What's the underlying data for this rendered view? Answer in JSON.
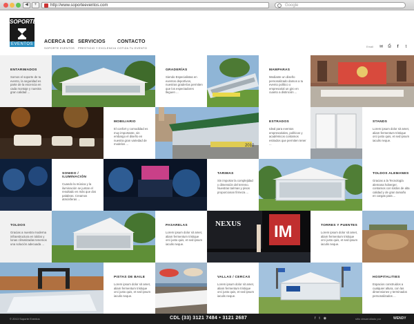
{
  "browser": {
    "url": "http://www.soporteeventos.com",
    "search_placeholder": "Google",
    "back": "◀",
    "forward": "▶",
    "add_tab": "+"
  },
  "logo": {
    "top_text": "SOPORTE",
    "bottom_text": "EVENTOS"
  },
  "menu": [
    {
      "title": "ACERCA DE",
      "subtitle": "SOPORTE EVENTOS"
    },
    {
      "title": "SERVICIOS",
      "subtitle": "PRESTIGIO Y EXCLENCIA"
    },
    {
      "title": "CONTACTO",
      "subtitle": "COTIZA TU EVENTO"
    }
  ],
  "social": {
    "label": "Email",
    "icons": [
      "envelope-icon",
      "printer-icon",
      "facebook-icon",
      "twitter-icon"
    ]
  },
  "tiles": [
    {
      "title": "ENTARIMADOS",
      "text": "Somos el soporte de tu evento, la seguridad es parte de la escencia en cada montaje y nuestra gran calidad ..."
    },
    {
      "title": "GRADERÍAS",
      "text": "Siendo Especialistas en eventos deportivos, nuestras graderías permiten que los espectadores lleguen ..."
    },
    {
      "title": "MAMPARAS",
      "text": "Mediante un diseño personalizado damos a tu evento político o empresarial un giro en cuanto a distinción ..."
    },
    {
      "title": "MOBILIARIO",
      "text": "El confort y comodidad es muy importante, sin embargo el diseño en nuestra gran variedad de modelos ..."
    },
    {
      "title": "ESTRADOS",
      "text": "Ideal para eventos empresariales, políticos y académicos contamos estrados que permiten tener ..."
    },
    {
      "title": "STANDS",
      "text": "Lorem ipsum dolor sit amet, aliam fermentum tristique orci justo quis, et sed ipsum iaculis neque."
    },
    {
      "title": "SONIDO / ILUMINACIÓN",
      "text": "Cuando la música y la iluminación se juntan el resultado es más que dos palabras. Creamos atmósferas ..."
    },
    {
      "title": "TARIMAS",
      "text": "Sin importar la complejidad y dimensión del terreno. Nuestras tarimas y pisos proporcionan firmeza ..."
    },
    {
      "title": "TOLDOS ALEMANES",
      "text": "Gracias a la Tecnología alemana hoberger, contamos con toldos de alta calidad y de gran tamaño en cargas para ..."
    },
    {
      "title": "TOLDOS",
      "text": "Gracias a nuestra moderna infraestructura en toldos y lonas climatizadas tenemos una solución adecuada ..."
    },
    {
      "title": "PASARELAS",
      "text": "Lorem ipsum dolor sit amet, aliam fermentum tristique orci justo quis, et sed ipsum iaculis neque."
    },
    {
      "title": "TORRES Y PUENTES",
      "text": "Lorem ipsum dolor sit amet, aliam fermentum tristique orci justo quis, et sed ipsum iaculis neque."
    },
    {
      "title": "PISTAS DE BAILE",
      "text": "Lorem ipsum dolor sit amet, aliam fermentum tristique orci justo quis, et sed ipsum iaculis neque."
    },
    {
      "title": "VALLAS / CERCAS",
      "text": "Lorem ipsum dolor sit amet, aliam fermentum tristique orci justo quis, et sed ipsum iaculis neque."
    },
    {
      "title": "HOSPITALITIES",
      "text": "Espacios construidos a cualquier altura, con las dimensiones y terminados personalizados ..."
    }
  ],
  "photo_texts": {
    "banner_2010": "2010",
    "nexus": "NEXUS",
    "im_mark": "IM"
  },
  "footer": {
    "copyright": "© 2013 Soporte Eventos",
    "phone": "CDL (33) 3121 7484  •  3121 2687",
    "developer": "sitio desarrollado por",
    "developer_mark": "WENDY"
  },
  "colors": {
    "accent": "#2c8fc0",
    "footer_bg": "#1c1c1c",
    "text_dark": "#222222"
  }
}
